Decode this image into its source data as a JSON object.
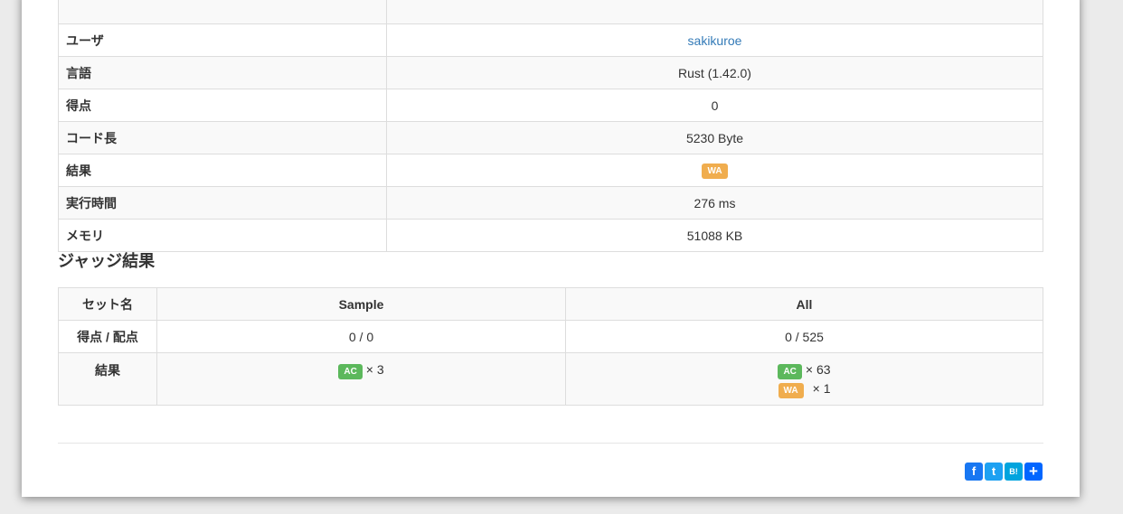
{
  "info_rows": [
    {
      "label": "",
      "value": ""
    },
    {
      "label": "ユーザ",
      "value": "sakikuroe"
    },
    {
      "label": "言語",
      "value": "Rust (1.42.0)"
    },
    {
      "label": "得点",
      "value": "0"
    },
    {
      "label": "コード長",
      "value": "5230 Byte"
    },
    {
      "label": "結果",
      "value": "WA"
    },
    {
      "label": "実行時間",
      "value": "276 ms"
    },
    {
      "label": "メモリ",
      "value": "51088 KB"
    }
  ],
  "judge": {
    "heading": "ジャッジ結果",
    "headers": [
      "セット名",
      "Sample",
      "All"
    ],
    "score_label": "得点 / 配点",
    "score_sample": "0 / 0",
    "score_all": "0 / 525",
    "result_label": "結果",
    "sample_ac": "AC",
    "sample_ac_count": "× 3",
    "all_ac": "AC",
    "all_ac_count": "× 63",
    "all_wa": "WA",
    "all_wa_count": "× 1"
  },
  "share": [
    "f",
    "t",
    "B!",
    "+"
  ],
  "colors": {
    "wa": "#f0ad4e",
    "ac": "#5cb85c",
    "link": "#337ab7"
  }
}
